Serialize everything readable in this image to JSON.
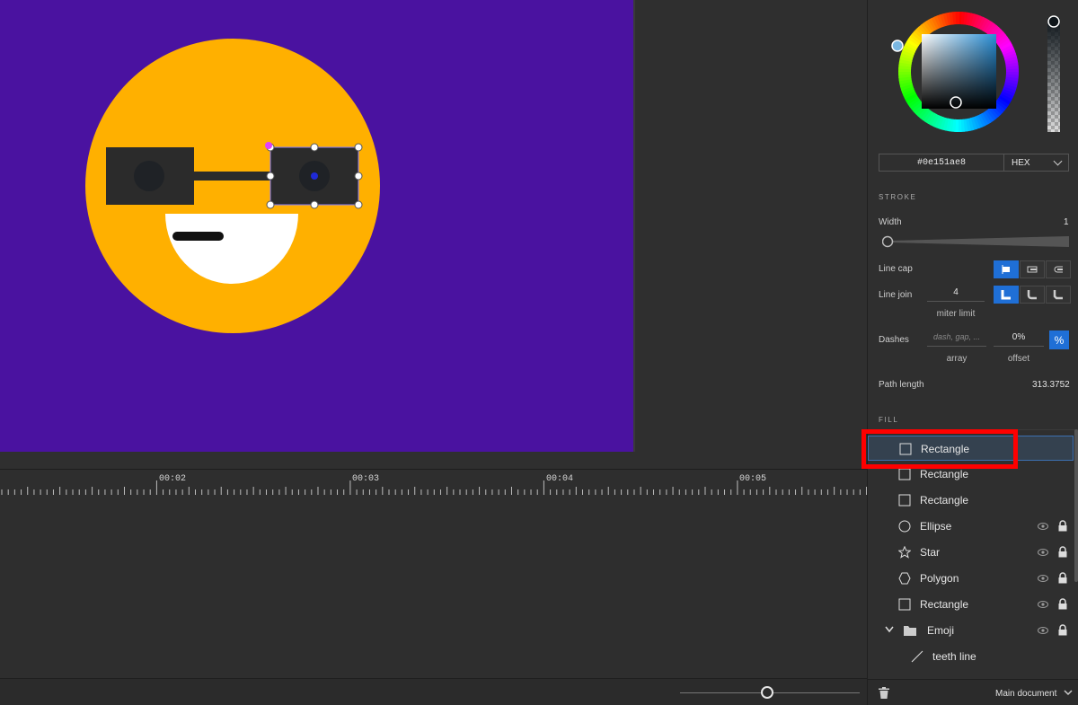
{
  "color_picker": {
    "hex_value": "#0e151ae8",
    "mode": "HEX",
    "accent_colors": {
      "selection": "#1f6fd6",
      "highlight": "#ff0000",
      "artboard": "#4a12a0",
      "emoji_face": "#ffb000"
    }
  },
  "stroke": {
    "section_title": "STROKE",
    "width_label": "Width",
    "width_value": "1",
    "line_cap_label": "Line cap",
    "line_join_label": "Line join",
    "miter_value": "4",
    "miter_label": "miter limit",
    "dashes_label": "Dashes",
    "dashes_placeholder": "dash, gap, ...",
    "dashes_array_label": "array",
    "offset_value": "0%",
    "offset_label": "offset",
    "percent_button": "%",
    "path_length_label": "Path length",
    "path_length_value": "313.3752"
  },
  "fill": {
    "section_title": "FILL"
  },
  "layers": [
    {
      "name": "Rectangle",
      "icon": "rectangle-icon",
      "selected": true
    },
    {
      "name": "Rectangle",
      "icon": "rectangle-icon"
    },
    {
      "name": "Rectangle",
      "icon": "rectangle-icon"
    },
    {
      "name": "Ellipse",
      "icon": "ellipse-icon"
    },
    {
      "name": "Star",
      "icon": "star-icon"
    },
    {
      "name": "Polygon",
      "icon": "polygon-icon"
    },
    {
      "name": "Rectangle",
      "icon": "rectangle-icon"
    },
    {
      "name": "Emoji",
      "icon": "folder-icon"
    },
    {
      "name": "teeth line",
      "icon": "line-icon"
    }
  ],
  "timeline": {
    "ruler_labels": [
      "00:02",
      "00:03",
      "00:04",
      "00:05"
    ]
  },
  "bottom": {
    "document_label": "Main document"
  }
}
